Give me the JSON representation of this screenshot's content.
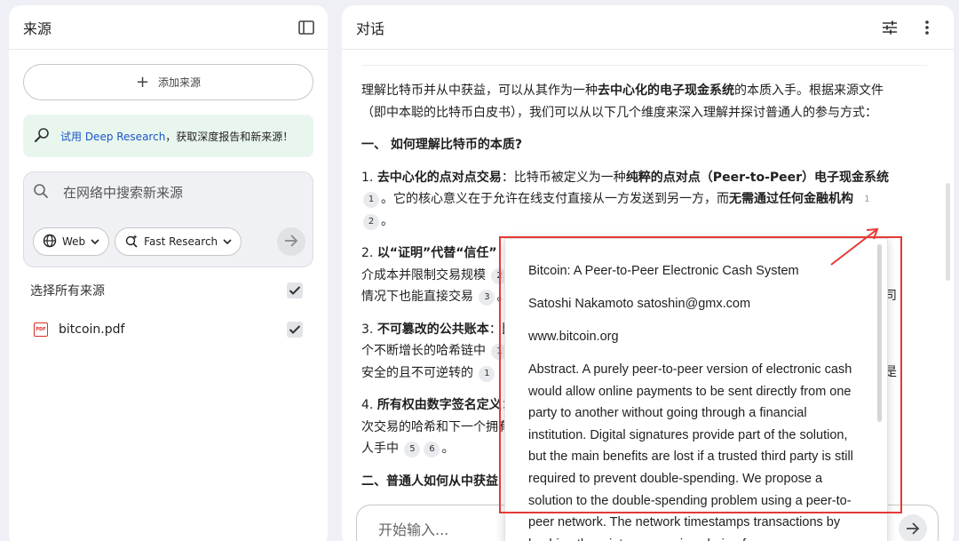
{
  "left": {
    "title": "来源",
    "add_source": "添加来源",
    "deep_research": {
      "link": "试用 Deep Research",
      "rest": "，获取深度报告和新来源！"
    },
    "search": {
      "placeholder": "在网络中搜索新来源",
      "web_chip": "Web",
      "research_chip": "Fast Research"
    },
    "select_all": "选择所有来源",
    "sources": [
      {
        "name": "bitcoin.pdf",
        "checked": true
      }
    ]
  },
  "right": {
    "title": "对话",
    "input_placeholder": "开始输入...",
    "intro": {
      "a": "理解比特币并从中获益，可以从其作为一种",
      "b": "去中心化的电子现金系统",
      "c": "的本质入手。根据来源文件（即中本聪的比特币白皮书），我们可以从以下几个维度来深入理解并探讨普通人的参与方式："
    },
    "section1": "一、 如何理解比特币的本质?",
    "item1": {
      "num": "1.",
      "bold": "去中心化的点对点交易",
      "a": "：比特币被定义为一种",
      "b": "纯粹的点对点（Peer-to-Peer）电子现金系统",
      "cite1": "1",
      "c": "。它的核心意义在于允许在线支付直接从一方发送到另一方，而",
      "d": "无需通过任何金融机构",
      "cite2": "1",
      "cite3": "2",
      "e": "。"
    },
    "item2": {
      "num": "2.",
      "bold": "以“证明”代替“信任”",
      "a": "：",
      "line2": "介成本并限制交易规模",
      "cite1": "2",
      "line3": "情况下也能直接交易",
      "cite2": "3",
      "tail": "。",
      "right_char": "司"
    },
    "item3": {
      "num": "3.",
      "bold": "不可篡改的公共账本",
      "a": "：比",
      "line2": "个不断增长的哈希链中",
      "cite1": "1",
      "line3": "安全的且不可逆转的",
      "cite2": "1",
      "right_char": "是"
    },
    "item4": {
      "num": "4.",
      "bold": "所有权由数字签名定义",
      "a": "：",
      "line2": "次交易的哈希和下一个拥有",
      "line3": "人手中",
      "cite1": "5",
      "cite2": "6",
      "tail": "。"
    },
    "section2_partial": "二、普通人如何从中获益"
  },
  "popup": {
    "title": "Bitcoin: A Peer-to-Peer Electronic Cash System",
    "author": "Satoshi Nakamoto satoshin@gmx.com",
    "site": "www.bitcoin.org",
    "abstract": "Abstract. A purely peer-to-peer version of electronic cash would allow online payments to be sent directly from one party to another without going through a financial institution. Digital signatures provide part of the solution, but the main benefits are lost if a trusted third party is still required to prevent double-spending. We propose a solution to the double-spending problem using a peer-to-peer network. The network timestamps transactions by hashing them into an ongoing chain of"
  },
  "colors": {
    "highlight": "#e53935",
    "link": "#1a56c8",
    "deep_research_bg": "#e9f6ee"
  }
}
